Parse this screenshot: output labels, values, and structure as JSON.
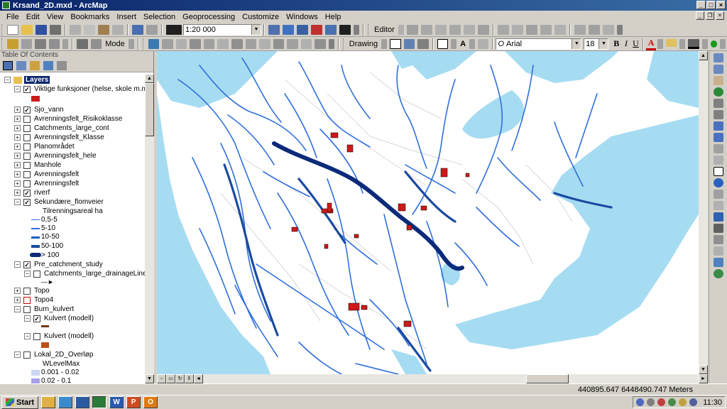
{
  "window": {
    "title": "Krsand_2D.mxd - ArcMap"
  },
  "menu": [
    "File",
    "Edit",
    "View",
    "Bookmarks",
    "Insert",
    "Selection",
    "Geoprocessing",
    "Customize",
    "Windows",
    "Help"
  ],
  "toolbar": {
    "scale": "1:20 000",
    "editor_label": "Editor",
    "mode_label": "Mode",
    "drawing_label": "Drawing",
    "font_name": "Arial",
    "font_size": "18",
    "bold": "B",
    "italic": "I",
    "underline": "U",
    "font_color_letter": "A"
  },
  "toc": {
    "title": "Table Of Contents",
    "root": "Layers",
    "layers": [
      {
        "name": "Viktige funksjoner (helse, skole m.m.)",
        "checked": true,
        "expanded": true
      },
      {
        "name": "Sjo_vann",
        "checked": true,
        "expanded": false
      },
      {
        "name": "Avrenningsfelt_Risikoklasse",
        "checked": false,
        "expanded": false
      },
      {
        "name": "Catchments_large_cont",
        "checked": false,
        "expanded": false
      },
      {
        "name": "Avrenningsfelt_Klasse",
        "checked": false,
        "expanded": false
      },
      {
        "name": "Planområdet",
        "checked": false,
        "expanded": false
      },
      {
        "name": "Avrenningsfelt_hele",
        "checked": false,
        "expanded": false
      },
      {
        "name": "Manhole",
        "checked": false,
        "expanded": false
      },
      {
        "name": "Avrenningsfelt",
        "checked": false,
        "expanded": false
      },
      {
        "name": "Avrenningsfelt",
        "checked": false,
        "expanded": false
      },
      {
        "name": "riverf",
        "checked": true,
        "expanded": false
      },
      {
        "name": "Sekundære_flomveier",
        "checked": true,
        "expanded": true
      }
    ],
    "flomveier_field": "Tilrenningsareal ha",
    "flomveier_classes": [
      "0,5-5",
      "5-10",
      "10-50",
      "50-100",
      "> 100"
    ],
    "pre_catchment": "Pre_catchment_study",
    "pre_catchment_sub": "Catchments_large_drainageLine",
    "topo": "Topo",
    "topo4": "Topo4",
    "burn_kulvert": "Burn_kulvert",
    "kulvert_checked": "Kulvert (modell)",
    "kulvert_unchecked": "Kulvert (modell)",
    "lokal_2d": "Lokal_2D_Overløp",
    "wlevel_field": "WLevelMax",
    "wlevel_classes": [
      "0.001 - 0.02",
      "0.02 - 0.1"
    ]
  },
  "colors": {
    "water": "#a6dcf2",
    "flow": "#2f6fdc",
    "flow_dark": "#0b2a7a",
    "building": "#cc1a1a",
    "map_bg": "#ffffff"
  },
  "status": {
    "coordinates": "440895.647  6448490.747 Meters"
  },
  "taskbar": {
    "start_label": "Start",
    "clock": "11:30"
  }
}
